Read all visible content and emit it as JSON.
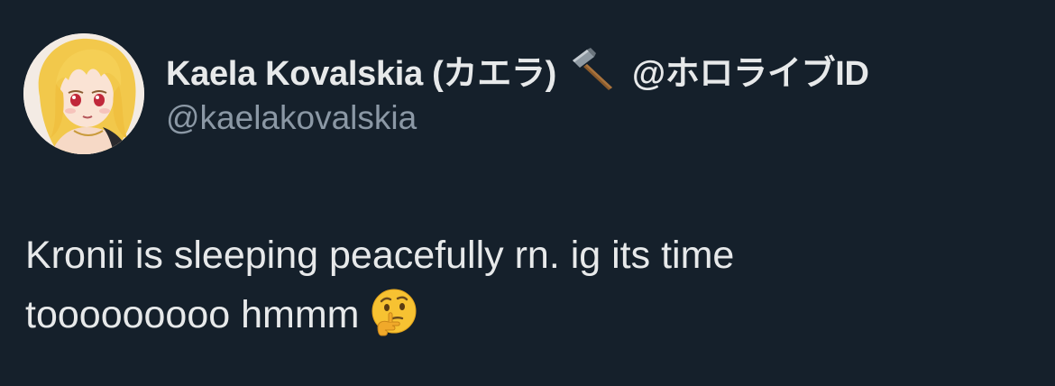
{
  "author": {
    "display_name": "Kaela Kovalskia (カエラ)",
    "display_name_suffix": "@ホロライブID",
    "handle": "@kaelakovalskia",
    "avatar_icon": "anime-avatar",
    "badge_icon": "hammer-icon"
  },
  "tweet": {
    "text_line1": "Kronii is sleeping peacefully rn. ig its time",
    "text_line2": "tooooooooo hmmm",
    "emoji_icon": "thinking-face-icon"
  },
  "colors": {
    "background": "#15202b",
    "primary_text": "#e7e9ea",
    "secondary_text": "#8b98a5"
  }
}
